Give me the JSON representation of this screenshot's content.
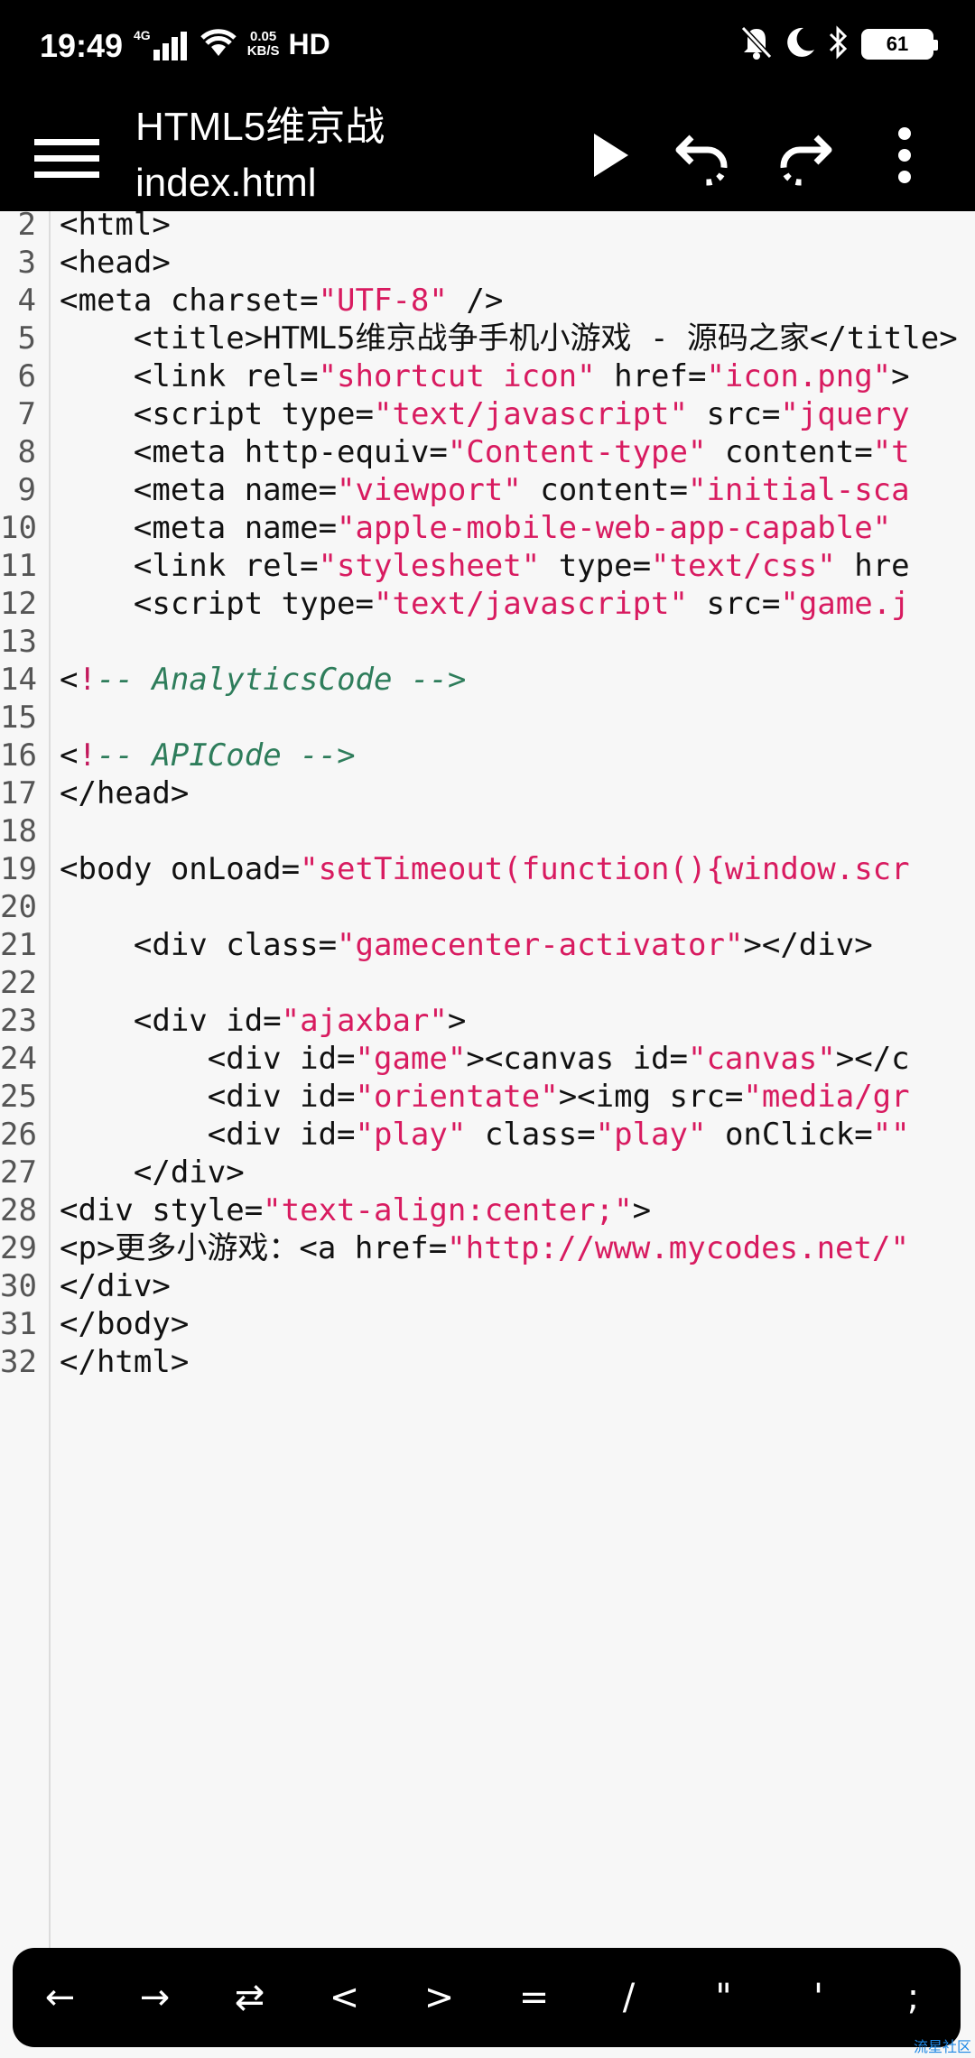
{
  "status_bar": {
    "time": "19:49",
    "network": "4G",
    "speed_value": "0.05",
    "speed_unit": "KB/S",
    "hd": "HD",
    "battery": "61"
  },
  "app_bar": {
    "title": "HTML5维京战",
    "subtitle": "index.html"
  },
  "editor": {
    "lines": [
      {
        "n": "2",
        "parts": [
          {
            "t": "<html>",
            "c": ""
          }
        ]
      },
      {
        "n": "3",
        "parts": [
          {
            "t": "<head>",
            "c": ""
          }
        ]
      },
      {
        "n": "4",
        "parts": [
          {
            "t": "<meta charset=",
            "c": ""
          },
          {
            "t": "\"UTF-8\"",
            "c": "str"
          },
          {
            "t": " />",
            "c": ""
          }
        ]
      },
      {
        "n": "5",
        "parts": [
          {
            "t": "    <title>HTML5维京战争手机小游戏 - 源码之家</title>",
            "c": ""
          }
        ]
      },
      {
        "n": "6",
        "parts": [
          {
            "t": "    <link rel=",
            "c": ""
          },
          {
            "t": "\"shortcut icon\"",
            "c": "str"
          },
          {
            "t": " href=",
            "c": ""
          },
          {
            "t": "\"icon.png\"",
            "c": "str"
          },
          {
            "t": ">",
            "c": ""
          }
        ]
      },
      {
        "n": "7",
        "parts": [
          {
            "t": "    <script type=",
            "c": ""
          },
          {
            "t": "\"text/javascript\"",
            "c": "str"
          },
          {
            "t": " src=",
            "c": ""
          },
          {
            "t": "\"jquery",
            "c": "str"
          }
        ]
      },
      {
        "n": "8",
        "parts": [
          {
            "t": "    <meta http-equiv=",
            "c": ""
          },
          {
            "t": "\"Content-type\"",
            "c": "str"
          },
          {
            "t": " content=",
            "c": ""
          },
          {
            "t": "\"t",
            "c": "str"
          }
        ]
      },
      {
        "n": "9",
        "parts": [
          {
            "t": "    <meta name=",
            "c": ""
          },
          {
            "t": "\"viewport\"",
            "c": "str"
          },
          {
            "t": " content=",
            "c": ""
          },
          {
            "t": "\"initial-sca",
            "c": "str"
          }
        ]
      },
      {
        "n": "10",
        "parts": [
          {
            "t": "    <meta name=",
            "c": ""
          },
          {
            "t": "\"apple-mobile-web-app-capable\"",
            "c": "str"
          }
        ]
      },
      {
        "n": "11",
        "parts": [
          {
            "t": "    <link rel=",
            "c": ""
          },
          {
            "t": "\"stylesheet\"",
            "c": "str"
          },
          {
            "t": " type=",
            "c": ""
          },
          {
            "t": "\"text/css\"",
            "c": "str"
          },
          {
            "t": " hre",
            "c": ""
          }
        ]
      },
      {
        "n": "12",
        "parts": [
          {
            "t": "    <script type=",
            "c": ""
          },
          {
            "t": "\"text/javascript\"",
            "c": "str"
          },
          {
            "t": " src=",
            "c": ""
          },
          {
            "t": "\"game.j",
            "c": "str"
          }
        ]
      },
      {
        "n": "13",
        "parts": []
      },
      {
        "n": "14",
        "parts": [
          {
            "t": "<",
            "c": ""
          },
          {
            "t": "!",
            "c": "bang"
          },
          {
            "t": "-- AnalyticsCode -->",
            "c": "cmt"
          }
        ]
      },
      {
        "n": "15",
        "parts": []
      },
      {
        "n": "16",
        "parts": [
          {
            "t": "<",
            "c": ""
          },
          {
            "t": "!",
            "c": "bang"
          },
          {
            "t": "-- APICode -->",
            "c": "cmt"
          }
        ]
      },
      {
        "n": "17",
        "parts": [
          {
            "t": "</head>",
            "c": ""
          }
        ]
      },
      {
        "n": "18",
        "parts": []
      },
      {
        "n": "19",
        "parts": [
          {
            "t": "<body onLoad=",
            "c": ""
          },
          {
            "t": "\"setTimeout(function(){window.scr",
            "c": "str"
          }
        ]
      },
      {
        "n": "20",
        "parts": []
      },
      {
        "n": "21",
        "parts": [
          {
            "t": "    <div class=",
            "c": ""
          },
          {
            "t": "\"gamecenter-activator\"",
            "c": "str"
          },
          {
            "t": "></div>",
            "c": ""
          }
        ]
      },
      {
        "n": "22",
        "parts": []
      },
      {
        "n": "23",
        "parts": [
          {
            "t": "    <div id=",
            "c": ""
          },
          {
            "t": "\"ajaxbar\"",
            "c": "str"
          },
          {
            "t": ">",
            "c": ""
          }
        ]
      },
      {
        "n": "24",
        "parts": [
          {
            "t": "        <div id=",
            "c": ""
          },
          {
            "t": "\"game\"",
            "c": "str"
          },
          {
            "t": "><canvas id=",
            "c": ""
          },
          {
            "t": "\"canvas\"",
            "c": "str"
          },
          {
            "t": "></c",
            "c": ""
          }
        ]
      },
      {
        "n": "25",
        "parts": [
          {
            "t": "        <div id=",
            "c": ""
          },
          {
            "t": "\"orientate\"",
            "c": "str"
          },
          {
            "t": "><img src=",
            "c": ""
          },
          {
            "t": "\"media/gr",
            "c": "str"
          }
        ]
      },
      {
        "n": "26",
        "parts": [
          {
            "t": "        <div id=",
            "c": ""
          },
          {
            "t": "\"play\"",
            "c": "str"
          },
          {
            "t": " class=",
            "c": ""
          },
          {
            "t": "\"play\"",
            "c": "str"
          },
          {
            "t": " onClick=",
            "c": ""
          },
          {
            "t": "\"\"",
            "c": "str"
          }
        ]
      },
      {
        "n": "27",
        "parts": [
          {
            "t": "    </div>",
            "c": ""
          }
        ]
      },
      {
        "n": "28",
        "parts": [
          {
            "t": "<div style=",
            "c": ""
          },
          {
            "t": "\"text-align:center;\"",
            "c": "str"
          },
          {
            "t": ">",
            "c": ""
          }
        ]
      },
      {
        "n": "29",
        "parts": [
          {
            "t": "<p>更多小游戏：<a href=",
            "c": ""
          },
          {
            "t": "\"http://www.mycodes.net/\"",
            "c": "str"
          }
        ]
      },
      {
        "n": "30",
        "parts": [
          {
            "t": "</div>",
            "c": ""
          }
        ]
      },
      {
        "n": "31",
        "parts": [
          {
            "t": "</body>",
            "c": ""
          }
        ]
      },
      {
        "n": "32",
        "parts": [
          {
            "t": "</html>",
            "c": ""
          }
        ]
      }
    ]
  },
  "symbol_bar": {
    "keys": [
      {
        "label": "←",
        "name": "arrow-left-key"
      },
      {
        "label": "→",
        "name": "arrow-right-key"
      },
      {
        "label": "⇄",
        "name": "swap-key"
      },
      {
        "label": "<",
        "name": "less-than-key"
      },
      {
        "label": ">",
        "name": "greater-than-key"
      },
      {
        "label": "=",
        "name": "equals-key"
      },
      {
        "label": "/",
        "name": "slash-key"
      },
      {
        "label": "\"",
        "name": "double-quote-key"
      },
      {
        "label": "'",
        "name": "single-quote-key"
      },
      {
        "label": ";",
        "name": "semicolon-key"
      }
    ]
  },
  "watermark": "流星社区",
  "icons": {
    "menu": "hamburger-menu-icon",
    "run": "play-icon",
    "undo": "undo-icon",
    "redo": "redo-icon",
    "more": "more-vert-icon"
  }
}
